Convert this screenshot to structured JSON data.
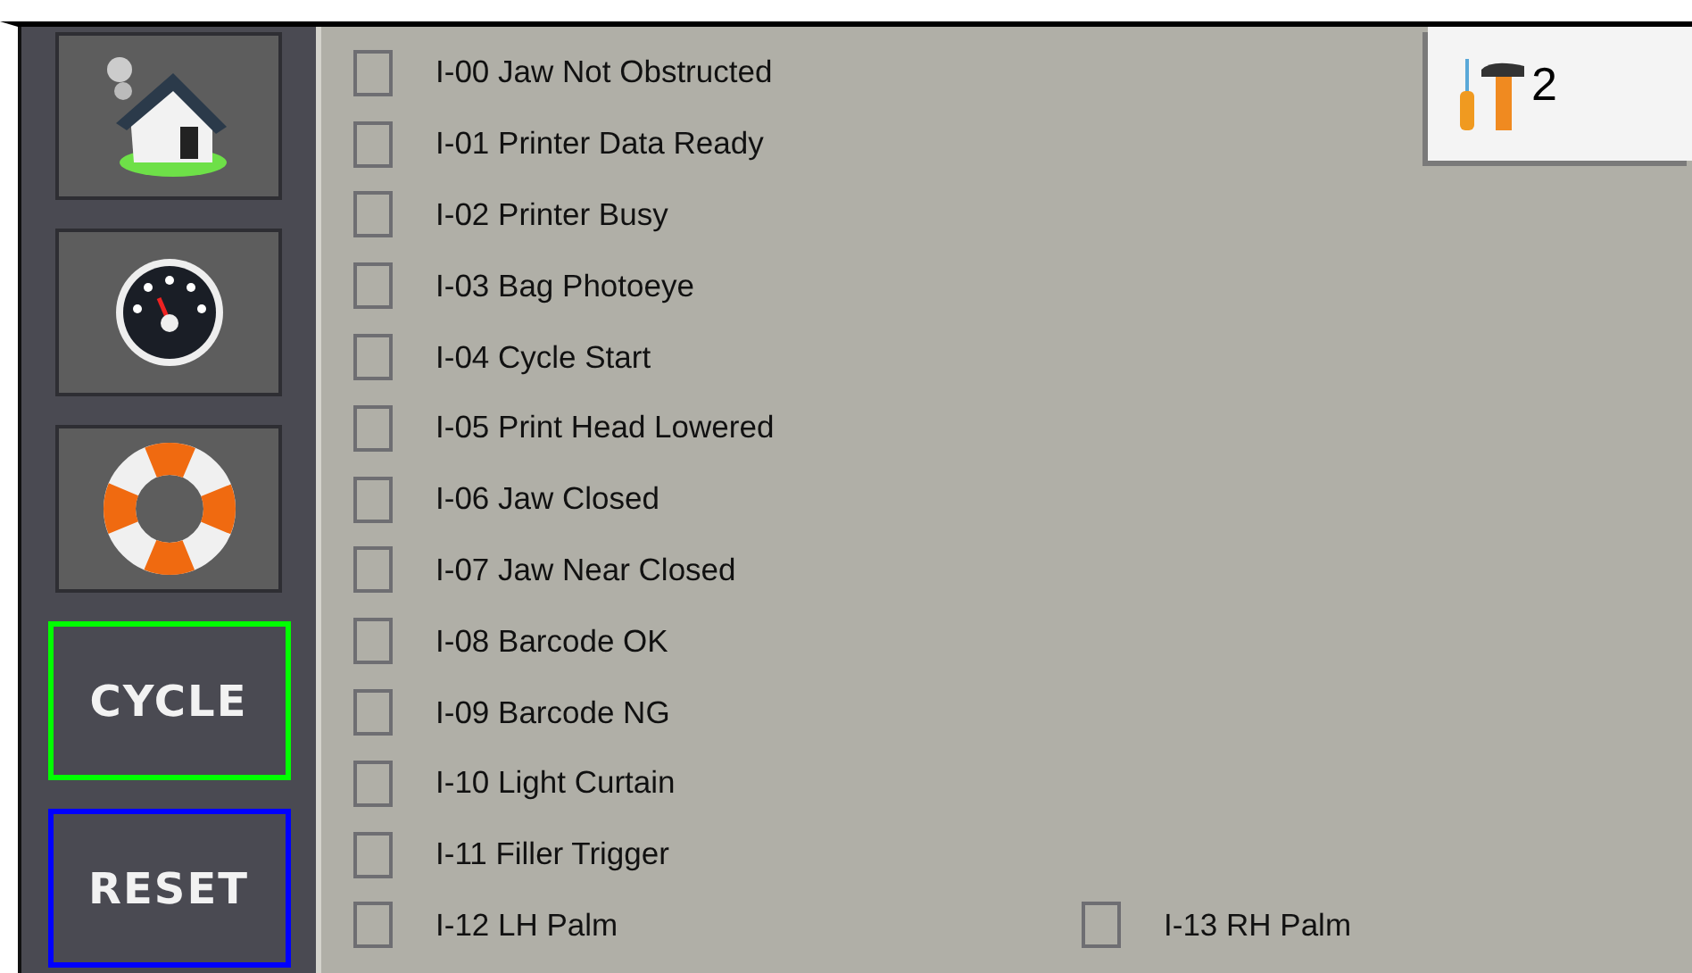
{
  "nav": [
    {
      "kind": "icon"
    },
    {
      "kind": "icon"
    },
    {
      "kind": "icon"
    },
    {
      "kind": "text",
      "label": "CYCLE",
      "color": "#00ff00"
    },
    {
      "kind": "text",
      "label": "RESET",
      "color": "#0000ff"
    }
  ],
  "rows": [
    {
      "items": [
        {
          "label": "I-00 Jaw Not Obstructed",
          "checked": false
        }
      ]
    },
    {
      "items": [
        {
          "label": "I-01 Printer Data Ready",
          "checked": false
        }
      ]
    },
    {
      "items": [
        {
          "label": "I-02 Printer Busy",
          "checked": false
        }
      ]
    },
    {
      "items": [
        {
          "label": "I-03 Bag Photoeye",
          "checked": false
        }
      ]
    },
    {
      "items": [
        {
          "label": "I-04 Cycle Start",
          "checked": false
        }
      ]
    },
    {
      "items": [
        {
          "label": "I-05 Print Head Lowered",
          "checked": false
        }
      ]
    },
    {
      "items": [
        {
          "label": "I-06 Jaw Closed",
          "checked": false
        }
      ]
    },
    {
      "items": [
        {
          "label": "I-07 Jaw Near Closed",
          "checked": false
        }
      ]
    },
    {
      "items": [
        {
          "label": "I-08 Barcode OK",
          "checked": false
        }
      ]
    },
    {
      "items": [
        {
          "label": "I-09 Barcode NG",
          "checked": false
        }
      ]
    },
    {
      "items": [
        {
          "label": "I-10 Light Curtain",
          "checked": false
        }
      ]
    },
    {
      "items": [
        {
          "label": "I-11 Filler Trigger",
          "checked": false
        }
      ]
    },
    {
      "items": [
        {
          "label": "I-12 LH Palm",
          "checked": false
        },
        {
          "label": "I-13 RH Palm",
          "checked": false
        }
      ]
    }
  ],
  "tools": {
    "label": "2"
  }
}
